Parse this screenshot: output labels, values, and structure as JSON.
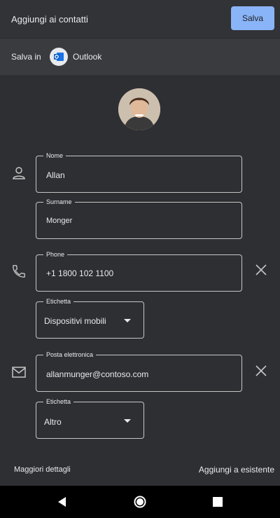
{
  "header": {
    "title": "Aggiungi ai contatti",
    "save_label": "Salva"
  },
  "save_in": {
    "label": "Salva in",
    "account": "Outlook"
  },
  "fields": {
    "first_name": {
      "label": "Nome",
      "value": "Allan"
    },
    "surname": {
      "label": "Surname",
      "value": "Monger"
    },
    "phone": {
      "label": "Phone",
      "value": "+1 1800 102 1100"
    },
    "phone_tag": {
      "label": "Etichetta",
      "value": "Dispositivi mobili"
    },
    "email": {
      "label": "Posta elettronica",
      "value": "allanmunger@contoso.com"
    },
    "email_tag": {
      "label": "Etichetta",
      "value": "Altro"
    }
  },
  "footer": {
    "more_details": "Maggiori dettagli",
    "add_existing": "Aggiungi a esistente"
  },
  "colors": {
    "accent": "#8ab4f8",
    "background": "#2e2f33",
    "text": "#e8eaed"
  },
  "icons": [
    "person-icon",
    "phone-icon",
    "mail-icon",
    "close-icon",
    "outlook-icon",
    "back-icon",
    "home-icon",
    "recents-icon"
  ]
}
